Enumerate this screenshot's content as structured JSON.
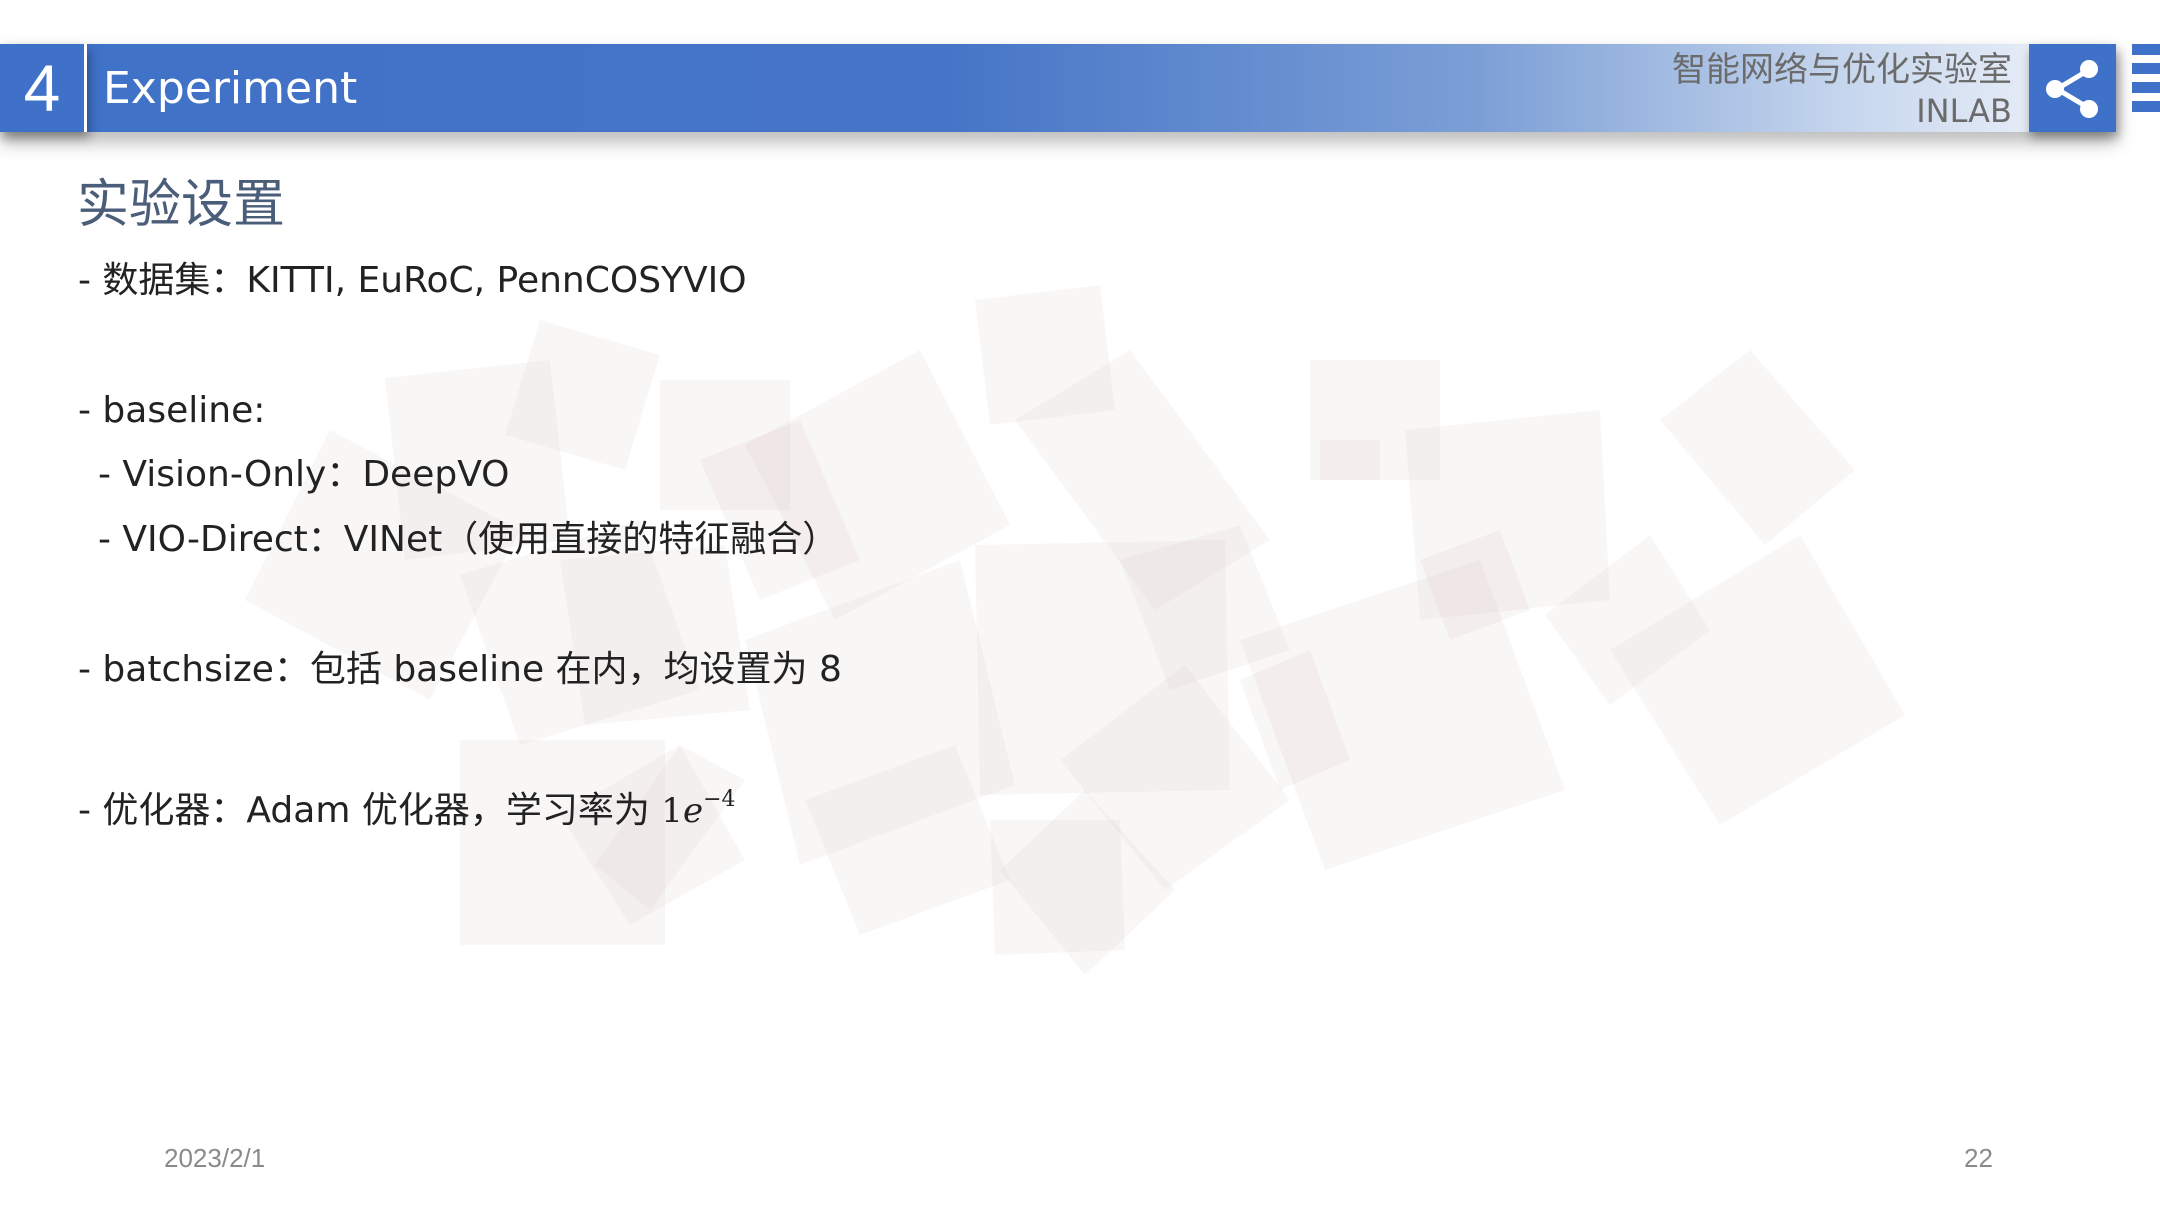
{
  "header": {
    "section_number": "4",
    "title": "Experiment",
    "lab_name": "智能网络与优化实验室",
    "lab_abbr": "INLAB"
  },
  "page_title": "实验设置",
  "bullets": {
    "dataset": "- 数据集：KITTI, EuRoC, PennCOSYVIO",
    "baseline": "- baseline:",
    "vision_only": "- Vision-Only：DeepVO",
    "vio_direct": "- VIO-Direct：VINet（使用直接的特征融合）",
    "batchsize": "- batchsize：包括 baseline 在内，均设置为 8",
    "optimizer": "- 优化器：Adam 优化器，学习率为 ",
    "lr_base": "1",
    "lr_e": "e",
    "lr_exp": "−4"
  },
  "footer": {
    "date": "2023/2/1",
    "page_number": "22"
  },
  "colors": {
    "header_blue": "#3f71c8",
    "title_text": "#4a5d79",
    "body_text": "#222222",
    "footer_text": "#8a8a8a"
  },
  "icons": {
    "share": "share-icon"
  }
}
